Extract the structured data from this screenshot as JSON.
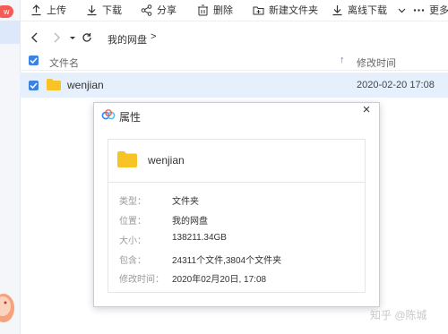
{
  "sidebar": {
    "badge": "w"
  },
  "toolbar": {
    "upload": "上传",
    "download": "下载",
    "share": "分享",
    "delete": "删除",
    "new_folder": "新建文件夹",
    "offline_download": "离线下载",
    "more": "更多"
  },
  "address": {
    "path": "我的网盘",
    "separator": ">"
  },
  "header": {
    "name_col": "文件名",
    "time_col": "修改时间"
  },
  "files": [
    {
      "name": "wenjian",
      "modified": "2020-02-20 17:08",
      "checked": true
    }
  ],
  "dialog": {
    "title": "属性",
    "close": "×",
    "folder_name": "wenjian",
    "rows": [
      {
        "label": "类型：",
        "value": "文件夹"
      },
      {
        "label": "位置：",
        "value": "我的网盘"
      },
      {
        "label": "大小：",
        "value": "138211.34GB"
      },
      {
        "label": "包含：",
        "value": "24311个文件,3804个文件夹"
      },
      {
        "label": "修改时间：",
        "value": "2020年02月20日, 17:08"
      }
    ]
  },
  "watermark": "知乎 @陈城",
  "colors": {
    "accent": "#3b82e6",
    "folder": "#f7c325",
    "selection": "#e6f0fc",
    "badge": "#f25c54"
  }
}
